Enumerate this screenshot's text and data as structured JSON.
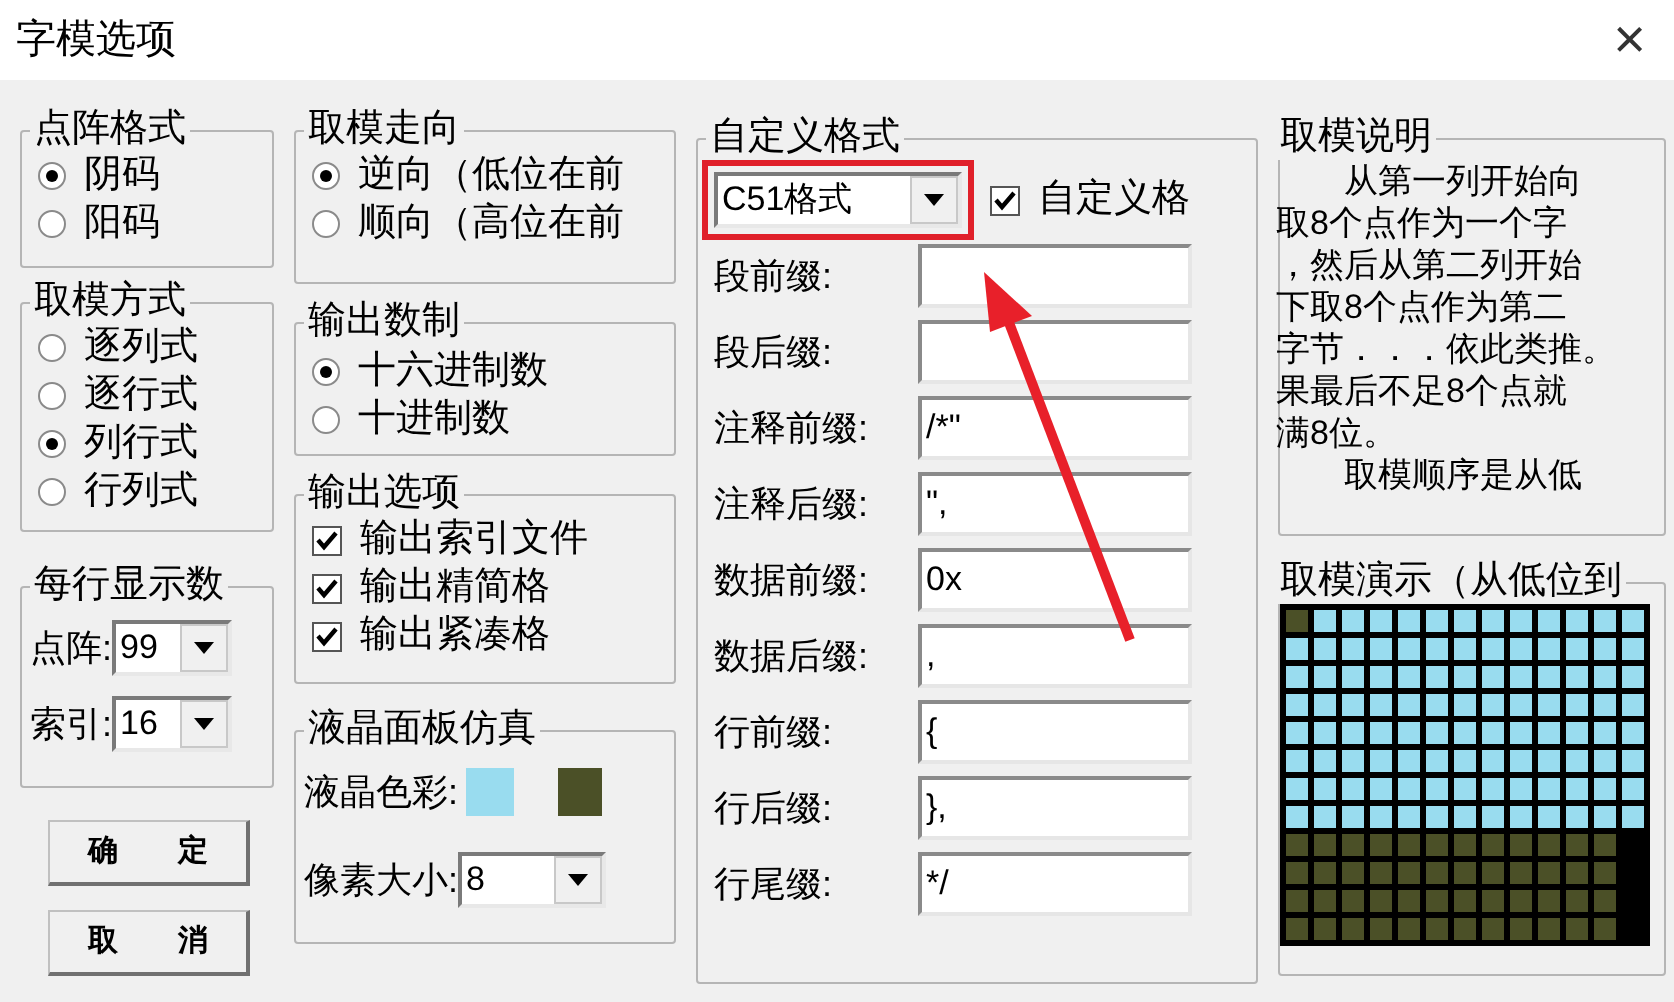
{
  "window": {
    "title": "字模选项",
    "close": "×"
  },
  "dot_format": {
    "title": "点阵格式",
    "options": [
      {
        "label": "阴码",
        "selected": true
      },
      {
        "label": "阳码",
        "selected": false
      }
    ]
  },
  "scan_mode": {
    "title": "取模方式",
    "options": [
      {
        "label": "逐列式",
        "selected": false
      },
      {
        "label": "逐行式",
        "selected": false
      },
      {
        "label": "列行式",
        "selected": true
      },
      {
        "label": "行列式",
        "selected": false
      }
    ]
  },
  "per_line": {
    "title": "每行显示数",
    "fields": [
      {
        "label": "点阵:",
        "value": "99"
      },
      {
        "label": "索引:",
        "value": "16"
      }
    ]
  },
  "buttons": [
    "确　　定",
    "取　　消"
  ],
  "direction": {
    "title": "取模走向",
    "options": [
      {
        "label": "逆向（低位在前",
        "selected": true
      },
      {
        "label": "顺向（高位在前",
        "selected": false
      }
    ]
  },
  "number_base": {
    "title": "输出数制",
    "options": [
      {
        "label": "十六进制数",
        "selected": true
      },
      {
        "label": "十进制数",
        "selected": false
      }
    ]
  },
  "output_options": {
    "title": "输出选项",
    "items": [
      {
        "label": "输出索引文件",
        "checked": true
      },
      {
        "label": "输出精简格",
        "checked": true
      },
      {
        "label": "输出紧凑格",
        "checked": true
      }
    ]
  },
  "lcd": {
    "title": "液晶面板仿真",
    "color_label": "液晶色彩:",
    "swatches": [
      {
        "color": "#99dcef"
      },
      {
        "color": "#4b5027"
      }
    ],
    "pixel_size_label": "像素大小:",
    "pixel_size": "8"
  },
  "custom_format": {
    "title": "自定义格式",
    "preset": "C51格式",
    "custom_checkbox": {
      "label": "自定义格",
      "checked": true
    },
    "fields": [
      {
        "label": "段前缀:"
      },
      {
        "label": "段后缀:"
      },
      {
        "label": "注释前缀:",
        "value": "/*\""
      },
      {
        "label": "注释后缀:",
        "value": "\","
      },
      {
        "label": "数据前缀:",
        "value": "0x"
      },
      {
        "label": "数据后缀:",
        "value": ","
      },
      {
        "label": "行前缀:",
        "value": "{"
      },
      {
        "label": "行后缀:",
        "value": "},"
      },
      {
        "label": "行尾缀:",
        "value": "*/"
      }
    ]
  },
  "description": {
    "title": "取模说明",
    "lines": [
      {
        "text": "从第一列开始向",
        "indent": true
      },
      {
        "text": "取8个点作为一个字",
        "indent": false
      },
      {
        "text": "，然后从第二列开始",
        "indent": false
      },
      {
        "text": "下取8个点作为第二",
        "indent": false
      },
      {
        "text": "字节．．．依此类推。",
        "indent": false
      },
      {
        "text": "果最后不足8个点就",
        "indent": false
      },
      {
        "text": "满8位。",
        "indent": false
      },
      {
        "text": "取模顺序是从低",
        "indent": true
      }
    ]
  },
  "demo": {
    "title": "取模演示（从低位到"
  }
}
